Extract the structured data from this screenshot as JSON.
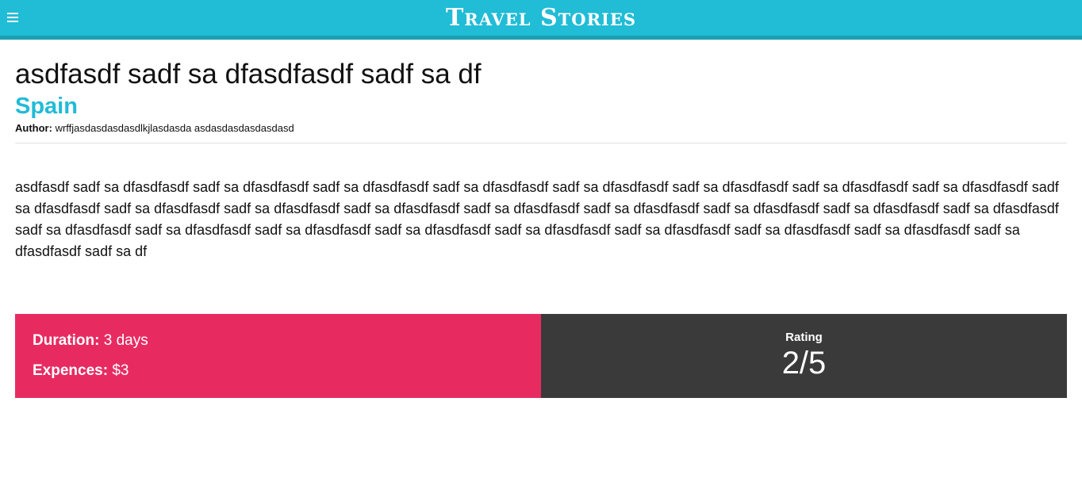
{
  "header": {
    "brand": "Travel Stories",
    "menu_icon": "hamburger-menu-icon"
  },
  "story": {
    "title": "asdfasdf sadf sa dfasdfasdf sadf sa df",
    "country": "Spain",
    "author_label": "Author:",
    "author_name": "wrffjasdasdasdasdlkjlasdasda asdasdasdasdasdasd",
    "body": "asdfasdf sadf sa dfasdfasdf sadf sa dfasdfasdf sadf sa dfasdfasdf sadf sa dfasdfasdf sadf sa dfasdfasdf sadf sa dfasdfasdf sadf sa dfasdfasdf sadf sa dfasdfasdf sadf sa dfasdfasdf sadf sa dfasdfasdf sadf sa dfasdfasdf sadf sa dfasdfasdf sadf sa dfasdfasdf sadf sa dfasdfasdf sadf sa dfasdfasdf sadf sa dfasdfasdf sadf sa dfasdfasdf sadf sa dfasdfasdf sadf sa dfasdfasdf sadf sa dfasdfasdf sadf sa dfasdfasdf sadf sa dfasdfasdf sadf sa dfasdfasdf sadf sa dfasdfasdf sadf sa dfasdfasdf sadf sa dfasdfasdf sadf sa df"
  },
  "stats": {
    "duration_label": "Duration:",
    "duration_value": "3 days",
    "expenses_label": "Expences:",
    "expenses_value": "$3",
    "rating_label": "Rating",
    "rating_value": "2/5"
  },
  "colors": {
    "header": "#21bcd6",
    "accent": "#21bcd6",
    "stats_left": "#e72b61",
    "stats_right": "#3a3a3a"
  }
}
